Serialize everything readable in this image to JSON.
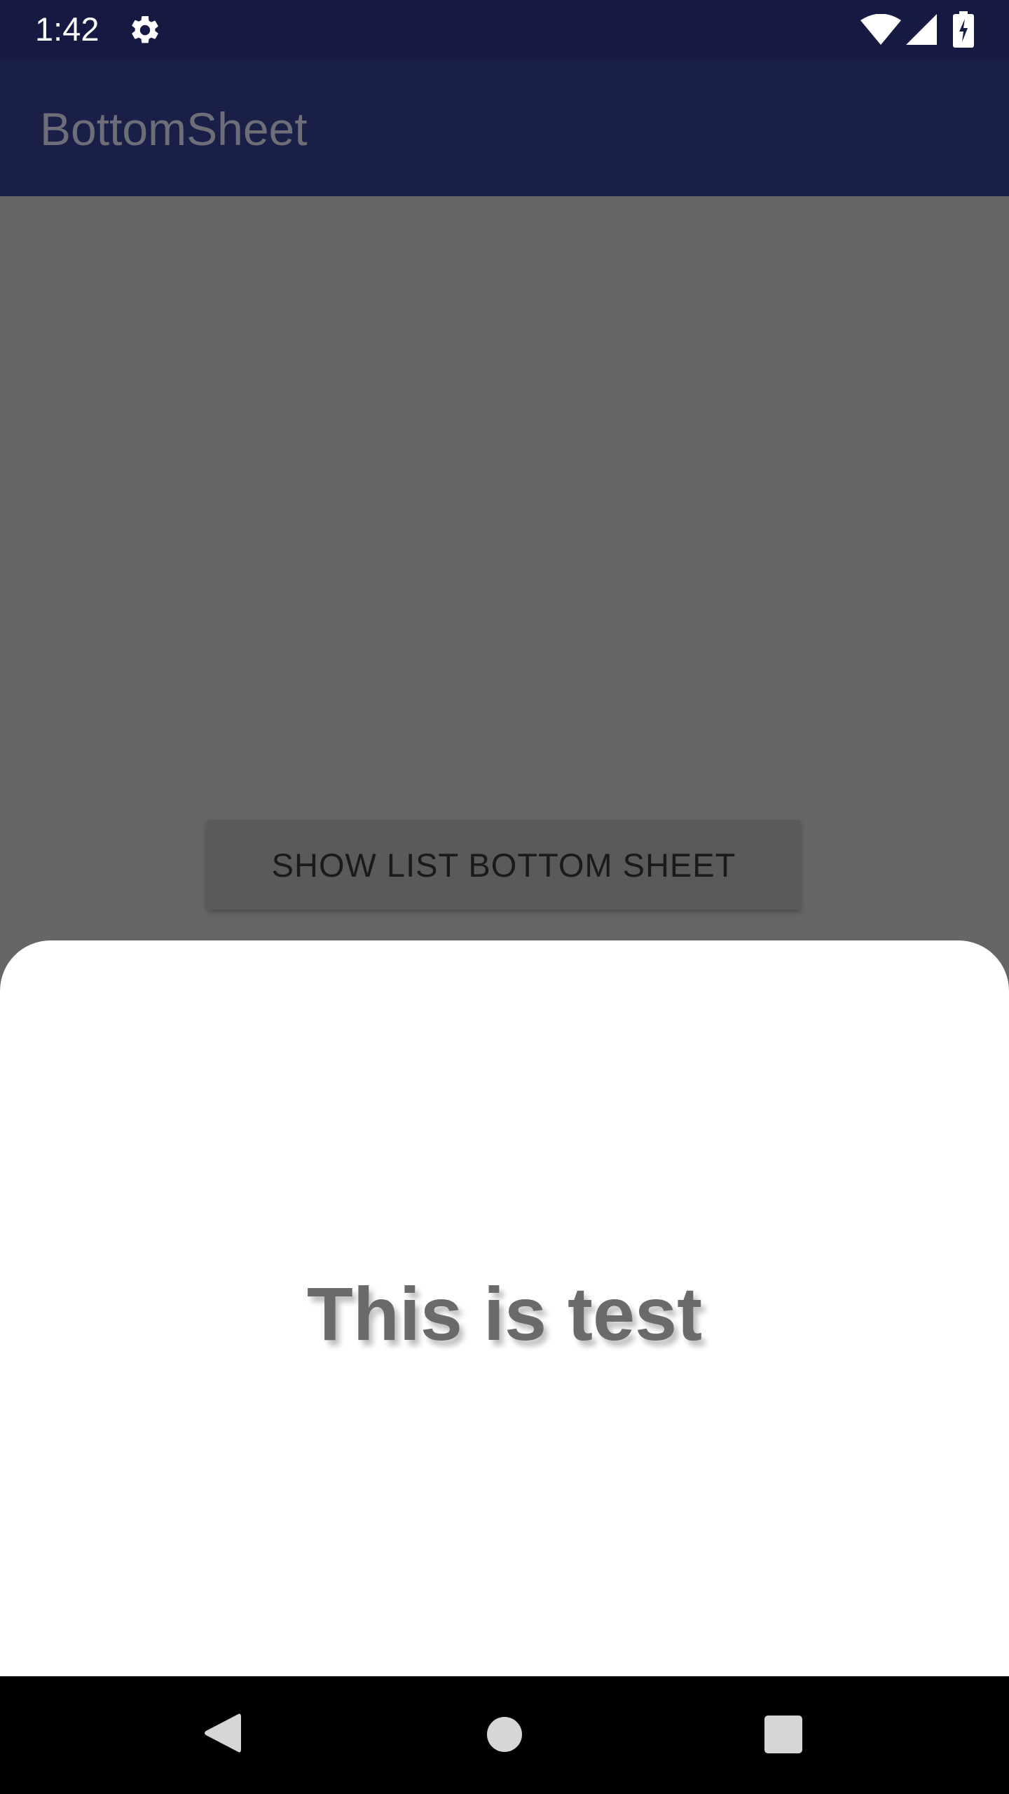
{
  "status_bar": {
    "time": "1:42",
    "icons": [
      "gear-icon",
      "wifi-icon",
      "cell-signal-icon",
      "battery-charging-icon"
    ]
  },
  "app_bar": {
    "title": "BottomSheet"
  },
  "main": {
    "show_sheet_button_label": "SHOW LIST BOTTOM SHEET"
  },
  "bottom_sheet": {
    "text": "This is test"
  },
  "nav_bar": {
    "icons": [
      "back-icon",
      "home-icon",
      "recents-icon"
    ]
  },
  "colors": {
    "status_bar_bg": "#161a42",
    "app_bar_bg": "#1a1f48",
    "scrim_bg": "#666666",
    "sheet_bg": "#ffffff",
    "nav_bar_bg": "#000000"
  }
}
